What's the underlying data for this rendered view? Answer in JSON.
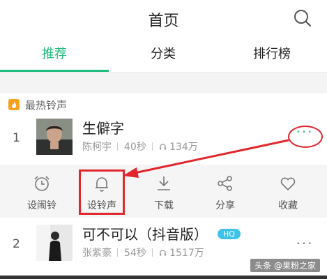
{
  "header": {
    "title": "首页",
    "search_icon": "search-icon"
  },
  "tabs": [
    {
      "label": "推荐",
      "active": true
    },
    {
      "label": "分类",
      "active": false
    },
    {
      "label": "排行榜",
      "active": false
    }
  ],
  "accent_color": "#1fbc7f",
  "section": {
    "title": "最热铃声",
    "icon": "fire-icon"
  },
  "songs": [
    {
      "rank": "1",
      "title": "生僻字",
      "artist": "陈柯宇",
      "duration": "40秒",
      "plays": "134万",
      "more": "···"
    },
    {
      "rank": "2",
      "title": "可不可以（抖音版）",
      "badge": "HQ",
      "artist": "张紫豪",
      "duration": "54秒",
      "plays": "1517万",
      "more": "···"
    }
  ],
  "actions": [
    {
      "label": "设闹铃",
      "icon": "alarm-clock-icon"
    },
    {
      "label": "设铃声",
      "icon": "bell-icon"
    },
    {
      "label": "下载",
      "icon": "download-icon"
    },
    {
      "label": "分享",
      "icon": "share-icon"
    },
    {
      "label": "收藏",
      "icon": "heart-icon"
    }
  ],
  "annotation_color": "#e0272d",
  "watermark": "头条 @果粉之家"
}
